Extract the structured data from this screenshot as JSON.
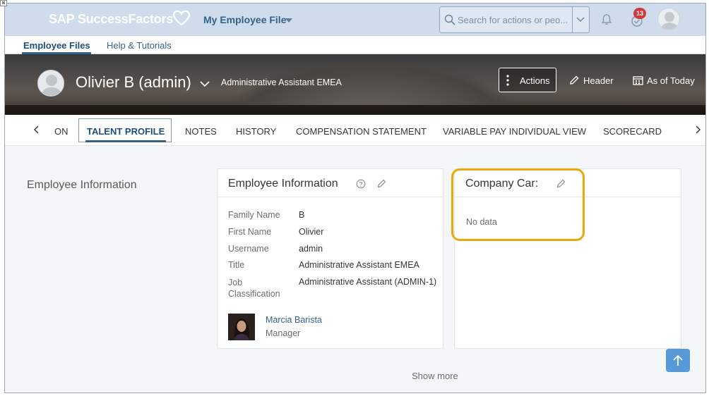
{
  "shell": {
    "brand": "SAP SuccessFactors",
    "module": "My Employee File",
    "search_placeholder": "Search for actions or peo...",
    "notification_count": "13"
  },
  "subnav": {
    "items": [
      "Employee Files",
      "Help & Tutorials"
    ]
  },
  "header": {
    "name": "Olivier B (admin)",
    "title": "Administrative Assistant EMEA",
    "actions_label": "Actions",
    "header_label": "Header",
    "as_of_label": "As of Today"
  },
  "tabs": {
    "clipped_label": "ON",
    "items": [
      "TALENT PROFILE",
      "NOTES",
      "HISTORY",
      "COMPENSATION STATEMENT",
      "VARIABLE PAY INDIVIDUAL VIEW",
      "SCORECARD"
    ]
  },
  "section": {
    "title": "Employee Information"
  },
  "employee_card": {
    "title": "Employee Information",
    "fields": [
      {
        "label": "Family Name",
        "value": "B"
      },
      {
        "label": "First Name",
        "value": "Olivier"
      },
      {
        "label": "Username",
        "value": "admin"
      },
      {
        "label": "Title",
        "value": "Administrative Assistant EMEA"
      },
      {
        "label": "Job Classification",
        "value": "Administrative Assistant (ADMIN-1)"
      }
    ],
    "manager_name": "Marcia Barista",
    "manager_role": "Manager"
  },
  "car_card": {
    "title": "Company Car:",
    "empty_text": "No data"
  },
  "footer": {
    "show_more": "Show more"
  },
  "colors": {
    "shell_bg": "#cfdcec",
    "link": "#346187",
    "highlight": "#e8a90c",
    "badge": "#d13b3b",
    "scroll_top_button": "#5899da"
  }
}
